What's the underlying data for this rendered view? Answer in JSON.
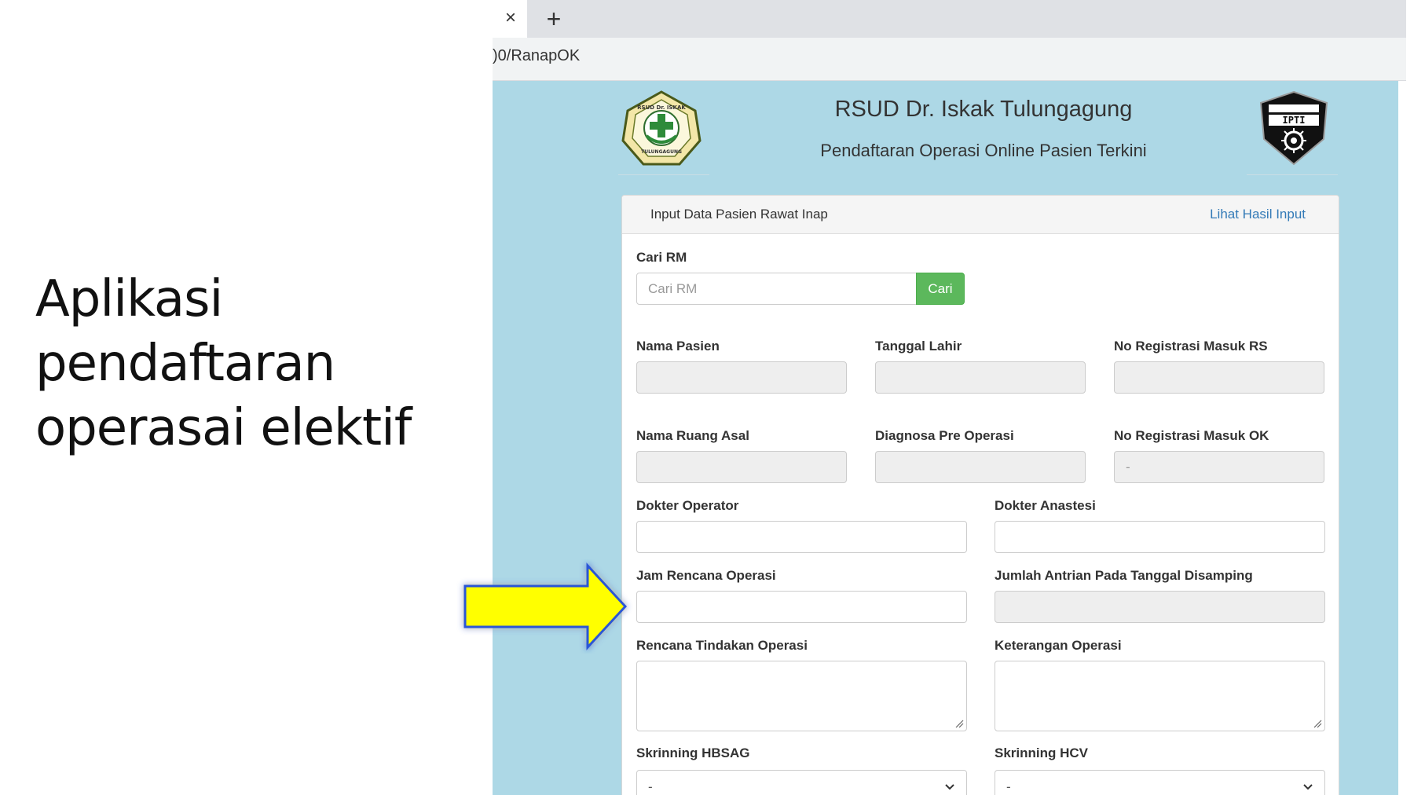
{
  "slide": {
    "title_lines": [
      "Aplikasi",
      "pendaftaran",
      "operasai elektif"
    ]
  },
  "browser": {
    "tab_close_icon": "×",
    "new_tab_icon": "+",
    "url": ")0/RanapOK"
  },
  "header": {
    "hospital_name": "RSUD Dr. Iskak Tulungagung",
    "subtitle": "Pendaftaran Operasi Online Pasien Terkini",
    "logo_left_text": "RSUD Dr. ISKAK TULUNGAGUNG",
    "logo_right_text": "IPTI",
    "colors": {
      "page_bg": "#add8e6",
      "button_green": "#5cb85c",
      "link_blue": "#337ab7",
      "arrow_yellow": "#ffff00"
    }
  },
  "panel": {
    "title": "Input Data Pasien Rawat Inap",
    "link": "Lihat Hasil Input"
  },
  "form": {
    "cari_rm": {
      "label": "Cari RM",
      "placeholder": "Cari RM",
      "button": "Cari"
    },
    "nama_pasien": {
      "label": "Nama Pasien",
      "value": ""
    },
    "tanggal_lahir": {
      "label": "Tanggal Lahir",
      "value": ""
    },
    "no_reg_rs": {
      "label": "No Registrasi Masuk RS",
      "value": ""
    },
    "nama_ruang": {
      "label": "Nama Ruang Asal",
      "value": ""
    },
    "diagnosa": {
      "label": "Diagnosa Pre Operasi",
      "value": ""
    },
    "no_reg_ok": {
      "label": "No Registrasi Masuk OK",
      "value": "-"
    },
    "dokter_operator": {
      "label": "Dokter Operator",
      "value": ""
    },
    "dokter_anastesi": {
      "label": "Dokter Anastesi",
      "value": ""
    },
    "jam_rencana": {
      "label": "Jam Rencana Operasi",
      "value": ""
    },
    "jumlah_antrian": {
      "label": "Jumlah Antrian Pada Tanggal Disamping",
      "value": ""
    },
    "rencana_tindakan": {
      "label": "Rencana Tindakan Operasi",
      "value": ""
    },
    "keterangan": {
      "label": "Keterangan Operasi",
      "value": ""
    },
    "hbsag": {
      "label": "Skrinning HBSAG",
      "selected": "-"
    },
    "hcv": {
      "label": "Skrinning HCV",
      "selected": "-"
    }
  }
}
